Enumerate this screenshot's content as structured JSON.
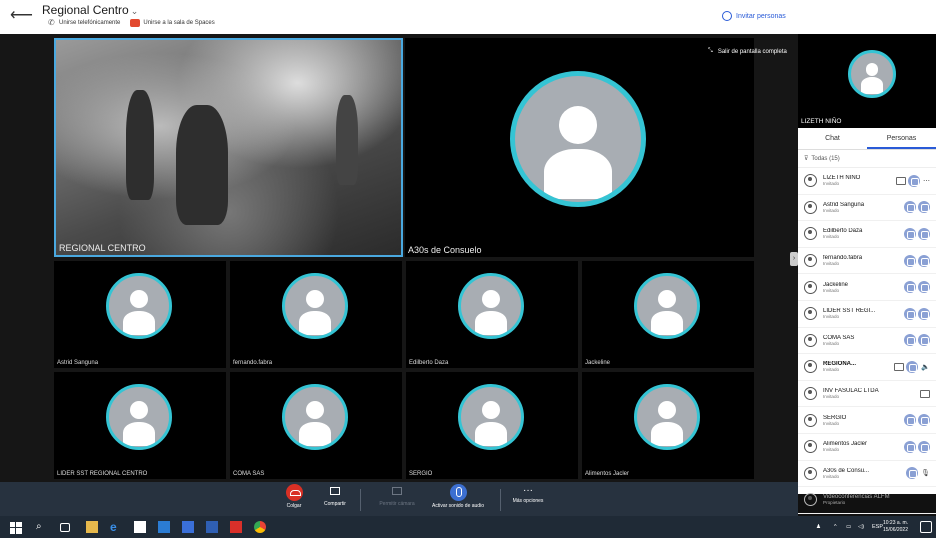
{
  "header": {
    "title": "Regional Centro",
    "join_phone": "Unirse telefónicamente",
    "join_spaces": "Unirse a la sala de Spaces",
    "invite": "Invitar personas"
  },
  "stage": {
    "exit_fullscreen": "Salir de pantalla completa",
    "main_tiles": [
      {
        "name": "REGIONAL CENTRO"
      },
      {
        "name": "A30s de Consuelo"
      }
    ],
    "grid_tiles": [
      {
        "name": "Astrid Sanguna"
      },
      {
        "name": "fernando.fabra"
      },
      {
        "name": "Edilberto Daza"
      },
      {
        "name": "Jackeline"
      },
      {
        "name": "LIDER SST REGIONAL CENTRO"
      },
      {
        "name": "COMA SAS"
      },
      {
        "name": "SERGIO"
      },
      {
        "name": "Alimentos Jacler"
      }
    ]
  },
  "panel": {
    "self_name": "LIZETH NIÑO",
    "tabs": [
      "Chat",
      "Personas"
    ],
    "filter": "Todas (15)",
    "participants": [
      {
        "name": "LIZETH NIÑO",
        "role": "Invitado"
      },
      {
        "name": "Astrid Sanguna",
        "role": "Invitado"
      },
      {
        "name": "Edilberto Daza",
        "role": "Invitado"
      },
      {
        "name": "fernando.fabra",
        "role": "Invitado"
      },
      {
        "name": "Jackeline",
        "role": "Invitado"
      },
      {
        "name": "LIDER SST REGI...",
        "role": "Invitado"
      },
      {
        "name": "COMA SAS",
        "role": "Invitado"
      },
      {
        "name": "REGIONA...",
        "role": "Invitado"
      },
      {
        "name": "INV FASULAC LTDA",
        "role": "Invitado"
      },
      {
        "name": "SERGIO",
        "role": "Invitado"
      },
      {
        "name": "Alimentos Jacler",
        "role": "Invitado"
      },
      {
        "name": "A30s de Consu...",
        "role": "Invitado"
      },
      {
        "name": "Videoconferencias ALFM",
        "role": "Propietario"
      }
    ]
  },
  "controls": {
    "hangup": "Colgar",
    "share": "Compartir",
    "allow_camera": "Permitir cámara",
    "unmute": "Activar sonido de audio",
    "more": "Más opciones"
  },
  "taskbar": {
    "lang": "ESP",
    "time": "10:23 a. m.",
    "date": "15/06/2022"
  }
}
